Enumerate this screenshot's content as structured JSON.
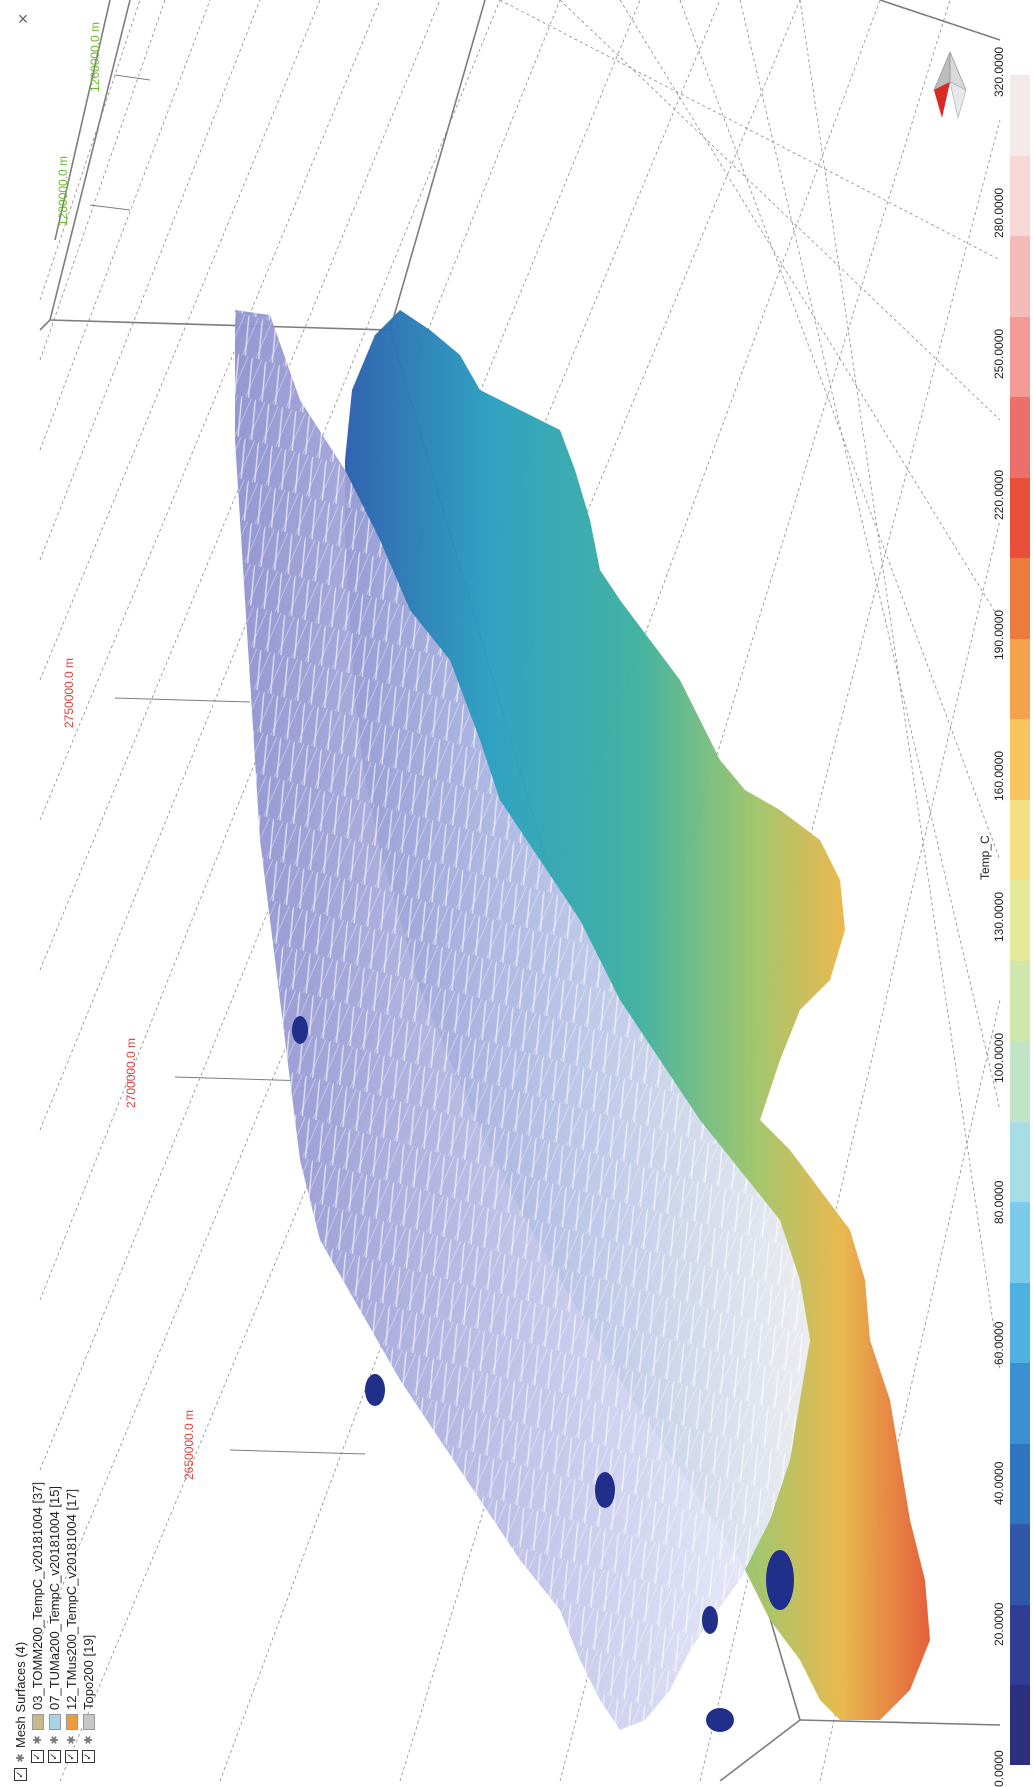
{
  "window": {
    "close_glyph": "×"
  },
  "legend": {
    "group": {
      "label": "Mesh Surfaces (4)",
      "checked": true
    },
    "items": [
      {
        "label": "03_TOMM200_TempC_v20181004 [37]",
        "checked": true,
        "color": "#c9b98a"
      },
      {
        "label": "07_TUMa200_TempC_v20181004 [15]",
        "checked": true,
        "color": "#a9d3e6"
      },
      {
        "label": "12_TMus200_TempC_v20181004 [17]",
        "checked": true,
        "color": "#f29a3c"
      },
      {
        "label": "Topo200 [19]",
        "checked": true,
        "color": "#c7c7c7"
      }
    ]
  },
  "axes": {
    "red_labels": [
      "2650000.0 m",
      "2700000.0 m",
      "2750000.0 m"
    ],
    "green_labels": [
      "1280000.0 m",
      "1260000.0 m"
    ]
  },
  "colorbar": {
    "title": "Temp_C",
    "ticks": [
      "0.0000",
      "20.0000",
      "40.0000",
      "60.0000",
      "80.0000",
      "100.0000",
      "130.0000",
      "160.0000",
      "190.0000",
      "220.0000",
      "250.0000",
      "280.0000",
      "320.0000"
    ],
    "colors": [
      "#2b2f7e",
      "#2f3e94",
      "#3057aa",
      "#2f74be",
      "#3a90d0",
      "#4fb0e2",
      "#7ccbea",
      "#a7dde4",
      "#c1e4c6",
      "#cfe7ad",
      "#e4ea9a",
      "#f3e083",
      "#f7c45f",
      "#f4a24b",
      "#ee7b3e",
      "#e8503c",
      "#ec6f6c",
      "#f19a96",
      "#f4bcb9",
      "#f6d8d6",
      "#f5eaea"
    ]
  },
  "icons": {
    "compass": "compass-icon",
    "visibility": "visibility-icon",
    "close": "close-icon"
  }
}
